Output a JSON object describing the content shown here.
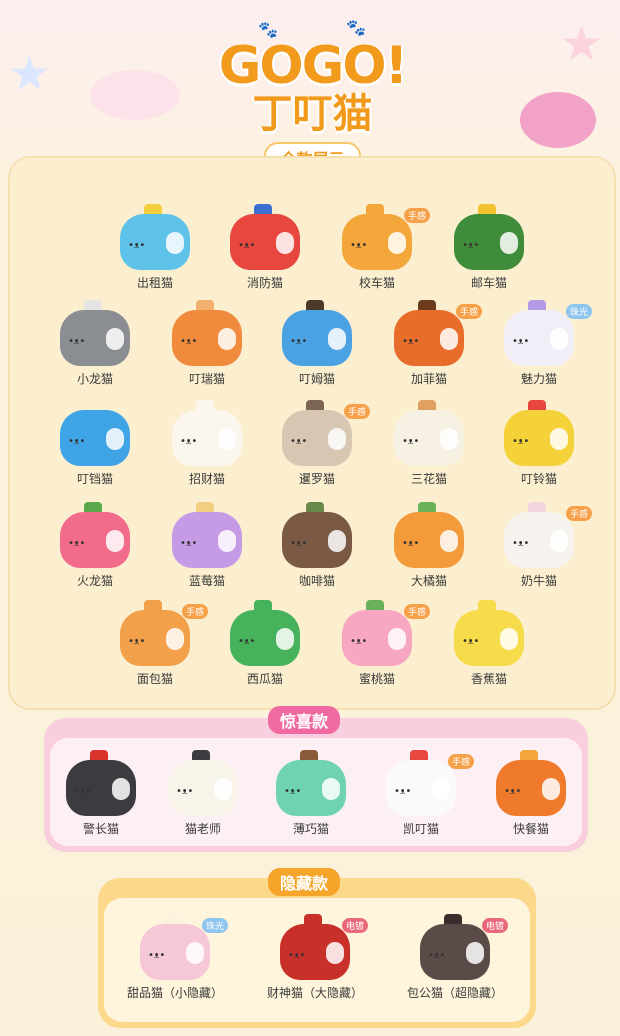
{
  "logo": {
    "line1": "GOGO!",
    "line2": "丁叮猫",
    "subtitle": "全款展示"
  },
  "colors": {
    "orange": "#f29a1b",
    "pink": "#ee6aa0",
    "gold": "#fbd88a"
  },
  "main": [
    {
      "name": "出租猫",
      "color": "#5fc2e8",
      "hat": "#f4d03f"
    },
    {
      "name": "消防猫",
      "color": "#e8473f",
      "hat": "#3d6fd0"
    },
    {
      "name": "校车猫",
      "color": "#f3a63a",
      "hat": "#f3a63a",
      "tag": "手感"
    },
    {
      "name": "邮车猫",
      "color": "#3f8d3a",
      "hat": "#f2c230"
    },
    {
      "name": "小龙猫",
      "color": "#8a8e93",
      "hat": "#e4e4e4"
    },
    {
      "name": "叮瑞猫",
      "color": "#f08a3c",
      "hat": "#f3b070"
    },
    {
      "name": "叮姆猫",
      "color": "#4aa2e2",
      "hat": "#4b3a2a"
    },
    {
      "name": "加菲猫",
      "color": "#e86d2a",
      "hat": "#6b3b1c",
      "tag": "手感"
    },
    {
      "name": "魅力猫",
      "color": "#f2eef7",
      "hat": "#b59ae6",
      "tag": "珠光"
    },
    {
      "name": "叮铛猫",
      "color": "#3fa4e6",
      "hat": ""
    },
    {
      "name": "招财猫",
      "color": "#fbf7ef",
      "hat": "#fbf7ef"
    },
    {
      "name": "暹罗猫",
      "color": "#d7c7b2",
      "hat": "#7b6452",
      "tag": "手感"
    },
    {
      "name": "三花猫",
      "color": "#f6f1e3",
      "hat": "#e0a062"
    },
    {
      "name": "叮铃猫",
      "color": "#f6d23a",
      "hat": "#e8473f"
    },
    {
      "name": "火龙猫",
      "color": "#f26b8a",
      "hat": "#5aa84a"
    },
    {
      "name": "蓝莓猫",
      "color": "#c59be6",
      "hat": "#f0d080"
    },
    {
      "name": "咖啡猫",
      "color": "#7a5a44",
      "hat": "#6a8a4a"
    },
    {
      "name": "大橘猫",
      "color": "#f39a3a",
      "hat": "#6ab25a"
    },
    {
      "name": "奶牛猫",
      "color": "#f6f3ee",
      "hat": "#f3d5e0",
      "tag": "手感"
    },
    {
      "name": "面包猫",
      "color": "#f2a04a",
      "hat": "#f2a04a",
      "tag": "手感"
    },
    {
      "name": "西瓜猫",
      "color": "#46b25c",
      "hat": "#46b25c"
    },
    {
      "name": "蜜桃猫",
      "color": "#f7a7c2",
      "hat": "#6ab25a",
      "tag": "手感"
    },
    {
      "name": "香蕉猫",
      "color": "#f6dc4a",
      "hat": "#f6dc4a"
    }
  ],
  "surprise": {
    "title": "惊喜款",
    "items": [
      {
        "name": "警长猫",
        "color": "#3c3c40",
        "hat": "#d9342b"
      },
      {
        "name": "猫老师",
        "color": "#f8f4ea",
        "hat": "#3c3c40"
      },
      {
        "name": "薄巧猫",
        "color": "#6fd3b2",
        "hat": "#8a5a3a"
      },
      {
        "name": "凯叮猫",
        "color": "#fafafa",
        "hat": "#e8473f",
        "tag": "手感"
      },
      {
        "name": "快餐猫",
        "color": "#f07a2c",
        "hat": "#f3a63a"
      }
    ]
  },
  "hidden": {
    "title": "隐藏款",
    "items": [
      {
        "name": "甜品猫（小隐藏）",
        "color": "#f6c7d6",
        "hat": "#fbf3dd",
        "tag": "珠光"
      },
      {
        "name": "财神猫（大隐藏）",
        "color": "#c8302a",
        "hat": "#c8302a",
        "tag": "电镀"
      },
      {
        "name": "包公猫（超隐藏）",
        "color": "#5a4a48",
        "hat": "#3a2e2c",
        "tag": "电镀"
      }
    ]
  }
}
